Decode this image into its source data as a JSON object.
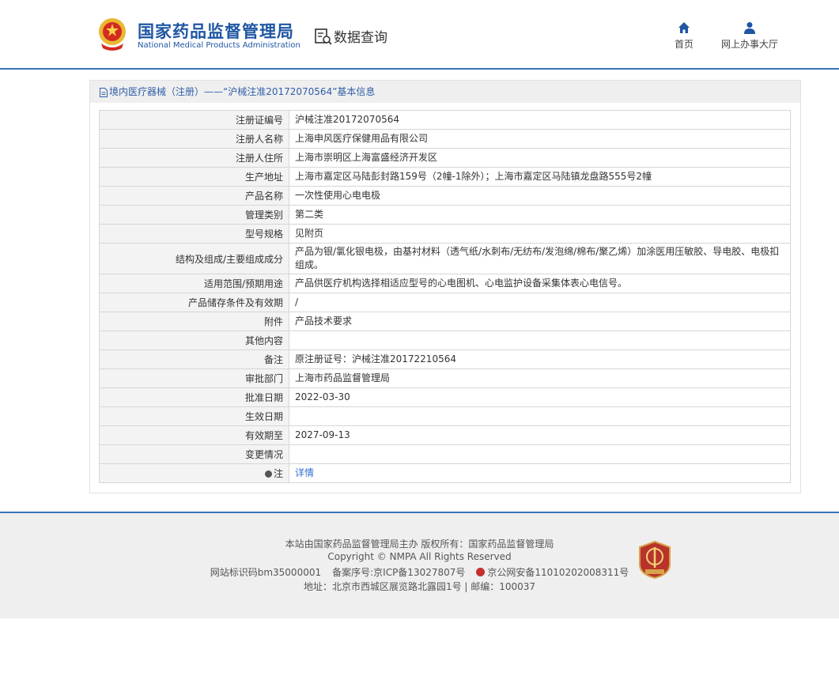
{
  "header": {
    "cn_title": "国家药品监督管理局",
    "en_title": "National Medical Products Administration",
    "query_title": "数据查询",
    "nav": {
      "home": "首页",
      "office": "网上办事大厅"
    }
  },
  "panel": {
    "breadcrumb": "境内医疗器械（注册）——“沪械注准20172070564”基本信息"
  },
  "rows": [
    {
      "label": "注册证编号",
      "value": "沪械注准20172070564"
    },
    {
      "label": "注册人名称",
      "value": "上海申风医疗保健用品有限公司"
    },
    {
      "label": "注册人住所",
      "value": "上海市崇明区上海富盛经济开发区"
    },
    {
      "label": "生产地址",
      "value": "上海市嘉定区马陆彭封路159号（2幢-1除外）；上海市嘉定区马陆镇龙盘路555号2幢"
    },
    {
      "label": "产品名称",
      "value": "一次性使用心电电极"
    },
    {
      "label": "管理类别",
      "value": "第二类"
    },
    {
      "label": "型号规格",
      "value": "见附页"
    },
    {
      "label": "结构及组成/主要组成成分",
      "value": "产品为银/氯化银电极，由基衬材料（透气纸/水刺布/无纺布/发泡绵/棉布/聚乙烯）加涂医用压敏胶、导电胶、电极扣组成。"
    },
    {
      "label": "适用范围/预期用途",
      "value": "产品供医疗机构选择相适应型号的心电图机、心电监护设备采集体表心电信号。"
    },
    {
      "label": "产品储存条件及有效期",
      "value": "/"
    },
    {
      "label": "附件",
      "value": "产品技术要求"
    },
    {
      "label": "其他内容",
      "value": ""
    },
    {
      "label": "备注",
      "value": "原注册证号：沪械注准20172210564"
    },
    {
      "label": "审批部门",
      "value": "上海市药品监督管理局"
    },
    {
      "label": "批准日期",
      "value": "2022-03-30"
    },
    {
      "label": "生效日期",
      "value": ""
    },
    {
      "label": "有效期至",
      "value": "2027-09-13"
    },
    {
      "label": "变更情况",
      "value": ""
    }
  ],
  "note_row": {
    "label": "注",
    "link": "详情"
  },
  "footer": {
    "line1": "本站由国家药品监督管理局主办 版权所有：国家药品监督管理局",
    "line2": "Copyright © NMPA All Rights Reserved",
    "site_id": "网站标识码bm35000001",
    "icp": "备案序号:京ICP备13027807号",
    "police": "京公网安备11010202008311号",
    "address": "地址：北京市西城区展览路北露园1号 | 邮编：100037"
  },
  "colors": {
    "brand_blue": "#1f56a3",
    "header_rule": "#3a73b7",
    "link": "#2f6fd0",
    "label_bg": "#f3f3f3"
  }
}
